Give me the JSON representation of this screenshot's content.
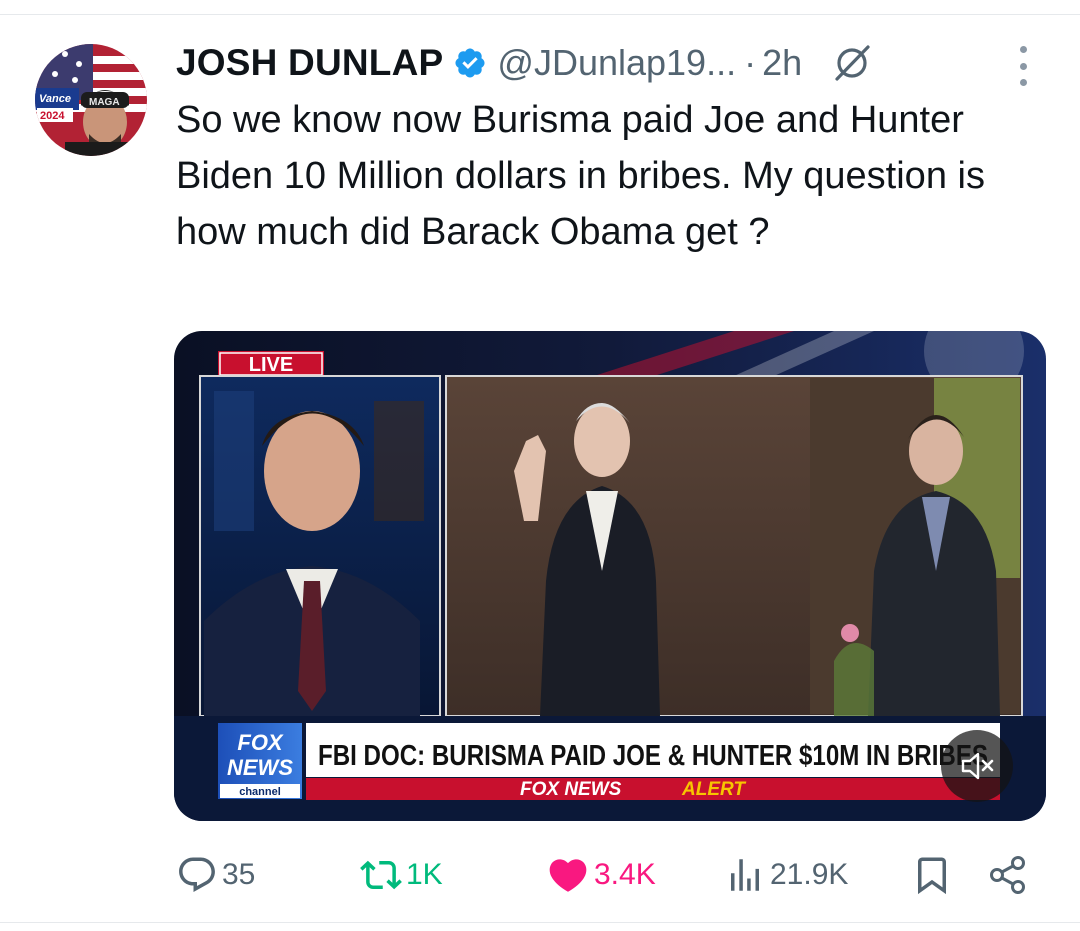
{
  "tweet": {
    "display_name": "JOSH DUNLAP",
    "handle": "@JDunlap19...",
    "separator": "·",
    "time": "2h",
    "text": "So we know now Burisma paid Joe and Hunter Biden 10 Million dollars in bribes. My question is how much did Barack Obama get ?",
    "verified_icon": "verified-badge-icon",
    "grok_icon": "grok-icon",
    "more_icon": "more-dots-icon"
  },
  "avatar": {
    "badge_text": "Vance",
    "badge_year": "2024",
    "hat_text": "MAGA"
  },
  "media": {
    "live_label": "LIVE",
    "network_line1": "FOX",
    "network_line2": "NEWS",
    "network_line3": "channel",
    "headline": "FBI DOC: BURISMA PAID JOE & HUNTER $10M IN BRIBES",
    "alert_prefix": "FOX NEWS",
    "alert_word": "ALERT",
    "mute_icon": "speaker-muted-icon"
  },
  "actions": {
    "replies": "35",
    "reposts": "1K",
    "likes": "3.4K",
    "views": "21.9K"
  },
  "colors": {
    "text": "#0f1419",
    "secondary": "#536471",
    "verified": "#1d9bf0",
    "repost": "#00ba7c",
    "like": "#f91880",
    "fox_red": "#c8102e",
    "fox_blue": "#0b2a6b",
    "alert_yellow": "#f7c600"
  }
}
